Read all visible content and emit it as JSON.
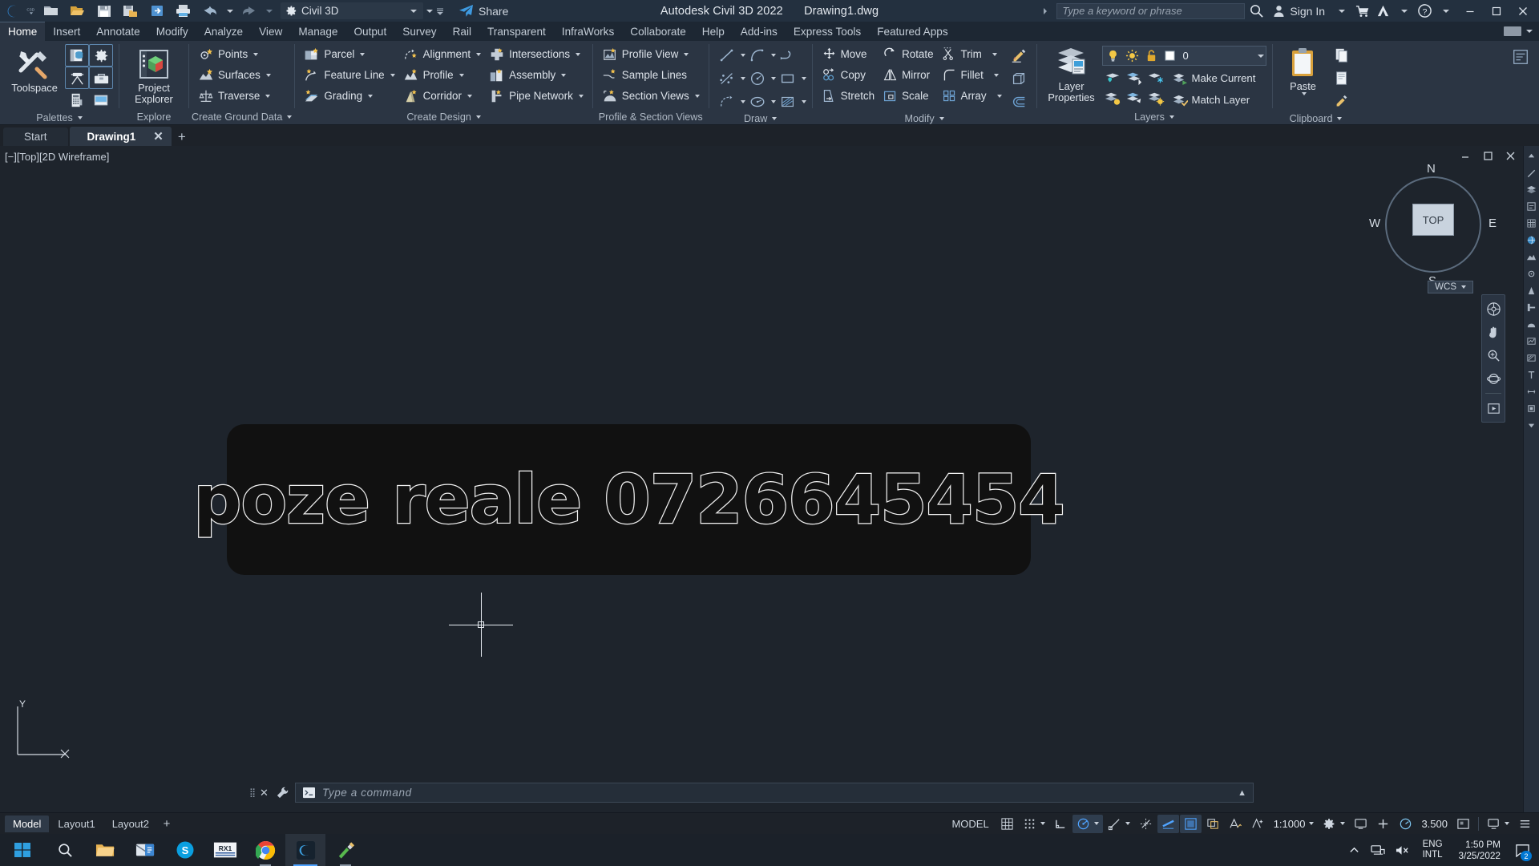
{
  "titlebar": {
    "app_icon": "autocad-c-logo",
    "qat": [
      {
        "name": "new-drawing",
        "icon": "new-file-icon"
      },
      {
        "name": "open-drawing",
        "icon": "open-folder-icon"
      },
      {
        "name": "save",
        "icon": "save-icon"
      },
      {
        "name": "save-as",
        "icon": "save-as-icon"
      },
      {
        "name": "export",
        "icon": "export-icon"
      },
      {
        "name": "plot",
        "icon": "printer-icon"
      },
      {
        "name": "undo",
        "icon": "undo-arrow-icon"
      },
      {
        "name": "redo",
        "icon": "redo-arrow-icon"
      }
    ],
    "workspace": "Civil 3D",
    "share_label": "Share",
    "document_title": "Autodesk Civil 3D 2022    Drawing1.dwg",
    "app_name": "Autodesk Civil 3D 2022",
    "file_name": "Drawing1.dwg",
    "search_placeholder": "Type a keyword or phrase",
    "sign_in": "Sign In",
    "window_controls": [
      "minimize",
      "restore",
      "close"
    ]
  },
  "ribbon": {
    "tabs": [
      {
        "label": "Home",
        "active": true
      },
      {
        "label": "Insert",
        "active": false
      },
      {
        "label": "Annotate",
        "active": false
      },
      {
        "label": "Modify",
        "active": false
      },
      {
        "label": "Analyze",
        "active": false
      },
      {
        "label": "View",
        "active": false
      },
      {
        "label": "Manage",
        "active": false
      },
      {
        "label": "Output",
        "active": false
      },
      {
        "label": "Survey",
        "active": false
      },
      {
        "label": "Rail",
        "active": false
      },
      {
        "label": "Transparent",
        "active": false
      },
      {
        "label": "InfraWorks",
        "active": false
      },
      {
        "label": "Collaborate",
        "active": false
      },
      {
        "label": "Help",
        "active": false
      },
      {
        "label": "Add-ins",
        "active": false
      },
      {
        "label": "Express Tools",
        "active": false
      },
      {
        "label": "Featured Apps",
        "active": false
      }
    ],
    "panels": {
      "palettes": {
        "title": "Palettes",
        "toolspace": "Toolspace",
        "icons": [
          "properties-icon",
          "settings-gear-icon",
          "survey-icon",
          "toolbox-icon",
          "calculator-icon",
          "panorama-icon"
        ]
      },
      "explore": {
        "title": "Explore",
        "project_explorer_line1": "Project",
        "project_explorer_line2": "Explorer"
      },
      "create_ground_data": {
        "title": "Create Ground Data",
        "items": [
          {
            "label": "Points",
            "icon": "points-icon",
            "dropdown": true
          },
          {
            "label": "Surfaces",
            "icon": "surfaces-icon",
            "dropdown": true
          },
          {
            "label": "Traverse",
            "icon": "traverse-icon",
            "dropdown": true
          }
        ]
      },
      "create_design": {
        "title": "Create Design",
        "col1": [
          {
            "label": "Parcel",
            "icon": "parcel-icon",
            "dropdown": true
          },
          {
            "label": "Feature Line",
            "icon": "feature-line-icon",
            "dropdown": true
          },
          {
            "label": "Grading",
            "icon": "grading-icon",
            "dropdown": true
          }
        ],
        "col2": [
          {
            "label": "Alignment",
            "icon": "alignment-icon",
            "dropdown": true
          },
          {
            "label": "Profile",
            "icon": "profile-icon",
            "dropdown": true
          },
          {
            "label": "Corridor",
            "icon": "corridor-icon",
            "dropdown": true
          }
        ],
        "col3": [
          {
            "label": "Intersections",
            "icon": "intersections-icon",
            "dropdown": true
          },
          {
            "label": "Assembly",
            "icon": "assembly-icon",
            "dropdown": true
          },
          {
            "label": "Pipe Network",
            "icon": "pipe-network-icon",
            "dropdown": true
          }
        ]
      },
      "profile_section_views": {
        "title": "Profile & Section Views",
        "items": [
          {
            "label": "Profile View",
            "icon": "profile-view-icon",
            "dropdown": true
          },
          {
            "label": "Sample Lines",
            "icon": "sample-lines-icon",
            "dropdown": false
          },
          {
            "label": "Section Views",
            "icon": "section-views-icon",
            "dropdown": true
          }
        ]
      },
      "draw": {
        "title": "Draw",
        "icons": [
          {
            "name": "line-icon",
            "dropdown": true
          },
          {
            "name": "arc-icon",
            "dropdown": true
          },
          {
            "name": "polyline-icon",
            "dropdown": false
          },
          {
            "name": "spline-icon",
            "dropdown": true
          },
          {
            "name": "circle-icon",
            "dropdown": true
          },
          {
            "name": "rectangle-icon",
            "dropdown": true
          },
          {
            "name": "feature-line-draw-icon",
            "dropdown": true
          },
          {
            "name": "ellipse-icon",
            "dropdown": true
          },
          {
            "name": "hatch-icon",
            "dropdown": true
          }
        ]
      },
      "modify": {
        "title": "Modify",
        "col1": [
          {
            "label": "Move",
            "icon": "move-icon"
          },
          {
            "label": "Copy",
            "icon": "copy-icon"
          },
          {
            "label": "Stretch",
            "icon": "stretch-icon"
          }
        ],
        "col2": [
          {
            "label": "Rotate",
            "icon": "rotate-icon"
          },
          {
            "label": "Mirror",
            "icon": "mirror-icon"
          },
          {
            "label": "Scale",
            "icon": "scale-icon"
          }
        ],
        "col3": [
          {
            "label": "Trim",
            "icon": "trim-scissors-icon",
            "dropdown": true
          },
          {
            "label": "Fillet",
            "icon": "fillet-icon",
            "dropdown": true
          },
          {
            "label": "Array",
            "icon": "array-icon",
            "dropdown": true
          }
        ],
        "col4": [
          {
            "name": "erase-pencil-icon"
          },
          {
            "name": "extrude-solid-icon"
          },
          {
            "name": "offset-icon"
          }
        ]
      },
      "layers": {
        "title": "Layers",
        "layer_properties_line1": "Layer",
        "layer_properties_line2": "Properties",
        "current_layer": "0",
        "state_icons": [
          "lightbulb-on-icon",
          "sun-icon",
          "unlock-icon",
          "layer-color-swatch"
        ],
        "make_current": "Make Current",
        "match_layer": "Match Layer",
        "row_icons": [
          "layer-off-icon",
          "layer-isolate-icon",
          "layer-freeze-icon",
          "layer-on-icon",
          "layer-unisolate-icon",
          "layer-thaw-icon"
        ]
      },
      "clipboard": {
        "title": "Clipboard",
        "paste_label": "Paste",
        "icons": [
          "copy-clip-icon",
          "cut-clip-icon",
          "match-properties-icon"
        ]
      }
    }
  },
  "document_tabs": [
    {
      "label": "Start",
      "active": false,
      "closable": false
    },
    {
      "label": "Drawing1",
      "active": true,
      "closable": true
    }
  ],
  "document_tab_add": "+",
  "viewport": {
    "label": "[−][Top][2D Wireframe]",
    "label_parts": [
      "[−]",
      "[Top]",
      "[2D Wireframe]"
    ],
    "controls": [
      "minimize-viewport",
      "maximize-viewport",
      "close-viewport"
    ],
    "viewcube": {
      "top": "TOP",
      "north": "N",
      "south": "S",
      "east": "E",
      "west": "W",
      "wcs": "WCS"
    },
    "ucs": {
      "x": "X",
      "y": "Y"
    },
    "navbar_tools": [
      "steering-wheel-icon",
      "pan-hand-icon",
      "zoom-extents-icon",
      "orbit-icon",
      "showmotion-icon"
    ]
  },
  "drawing_content": {
    "text_block": "poze reale 0726645454",
    "block_bg_color": "#111111",
    "text_stroke_color": "#f2f2f2"
  },
  "command_line": {
    "placeholder": "Type a command",
    "icon": "command-prompt-icon"
  },
  "status_bar": {
    "layout_tabs": [
      {
        "label": "Model",
        "active": true
      },
      {
        "label": "Layout1",
        "active": false
      },
      {
        "label": "Layout2",
        "active": false
      }
    ],
    "layout_add": "+",
    "model_label": "MODEL",
    "toggles": [
      {
        "name": "grid-display-icon",
        "on": false
      },
      {
        "name": "snap-mode-icon",
        "on": false,
        "dropdown": true
      },
      {
        "name": "ortho-mode-icon",
        "on": false
      },
      {
        "name": "polar-tracking-icon",
        "on": true,
        "dropdown": true
      },
      {
        "name": "object-snap-icon",
        "on": false,
        "dropdown": true
      },
      {
        "name": "object-snap-tracking-icon",
        "on": true
      },
      {
        "name": "lineweight-icon",
        "on": true
      },
      {
        "name": "transparency-icon",
        "on": false
      },
      {
        "name": "selection-cycling-icon",
        "on": false
      },
      {
        "name": "annotation-visibility-icon",
        "on": false
      }
    ],
    "annotation_scale": "1:1000",
    "workspace_switch_icon": "gear-icon",
    "hardware_accel_icon": "display-icon",
    "line_weight_value": "3.500",
    "customization_icon": "hamburger-icon",
    "fullscreen_icon": "fullscreen-icon"
  },
  "taskbar": {
    "start_icon": "windows-start-icon",
    "items": [
      {
        "name": "search-icon",
        "state": "idle"
      },
      {
        "name": "file-explorer-icon",
        "state": "idle"
      },
      {
        "name": "mail-icon",
        "state": "idle"
      },
      {
        "name": "skype-icon",
        "state": "idle"
      },
      {
        "name": "rx1-app-icon",
        "state": "idle",
        "label": "RX1"
      },
      {
        "name": "chrome-icon",
        "state": "open"
      },
      {
        "name": "civil3d-icon",
        "state": "active"
      },
      {
        "name": "paint-icon",
        "state": "open"
      }
    ],
    "tray": {
      "chevron_up": "show-hidden-icons",
      "network_icon": "network-icon",
      "volume_icon": "volume-muted-icon",
      "lang_line1": "ENG",
      "lang_line2": "INTL",
      "time": "1:50 PM",
      "date": "3/25/2022",
      "notifications_icon": "action-center-icon",
      "notifications_count": "2"
    }
  },
  "colors": {
    "titlebar_bg": "#23303f",
    "ribbon_bg": "#2b3543",
    "canvas_bg": "#1e242c",
    "accent_blue": "#4fa3ff",
    "status_bg": "#1d2229"
  }
}
